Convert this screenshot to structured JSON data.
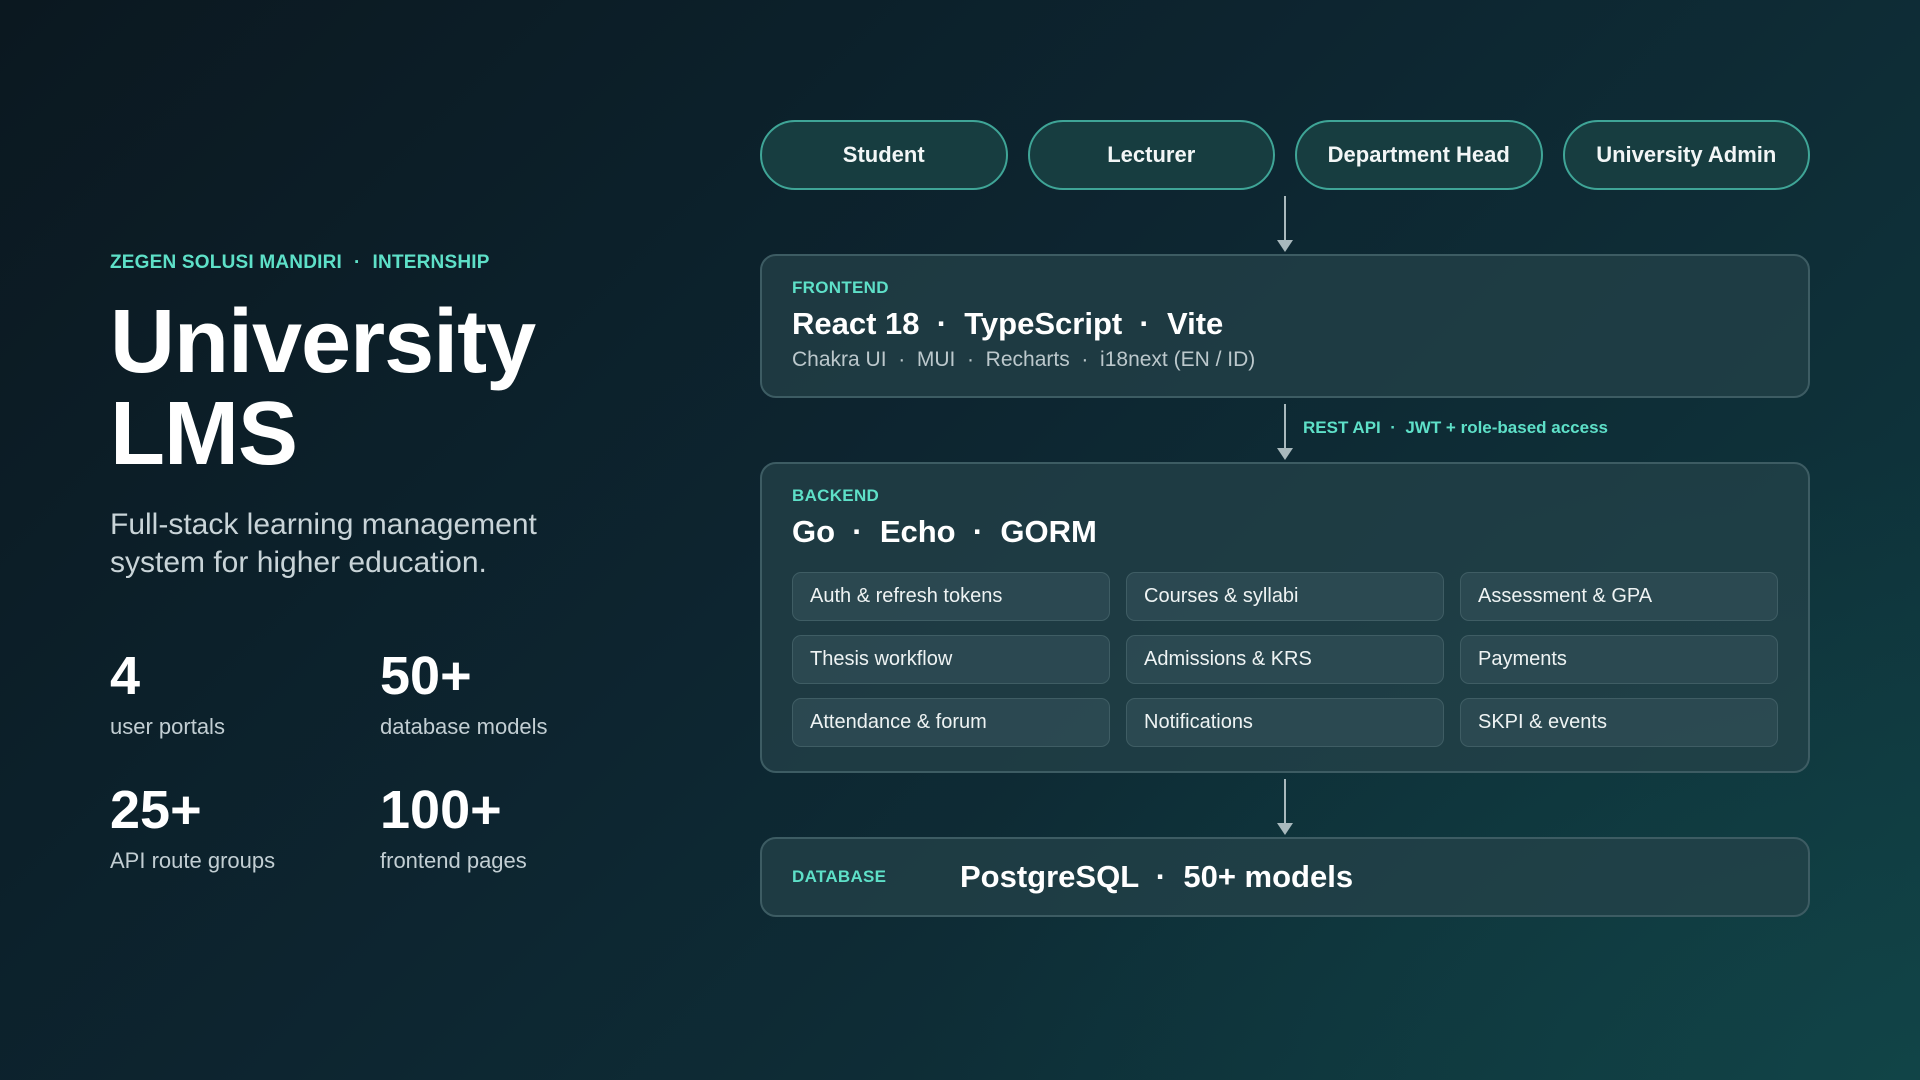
{
  "header": {
    "company": "ZEGEN SOLUSI MANDIRI",
    "separator": "·",
    "program": "INTERNSHIP"
  },
  "title": {
    "line1": "University",
    "line2": "LMS"
  },
  "subtitle": "Full-stack learning management system for higher education.",
  "stats": [
    {
      "value": "4",
      "label": "user portals"
    },
    {
      "value": "50+",
      "label": "database models"
    },
    {
      "value": "25+",
      "label": "API route groups"
    },
    {
      "value": "100+",
      "label": "frontend pages"
    }
  ],
  "roles": [
    "Student",
    "Lecturer",
    "Department Head",
    "University Admin"
  ],
  "frontend": {
    "tag": "FRONTEND",
    "main": "React 18  ·  TypeScript  ·  Vite",
    "sub": "Chakra UI  ·  MUI  ·  Recharts  ·  i18next (EN / ID)"
  },
  "connector": {
    "note": "REST API  ·  JWT + role-based access"
  },
  "backend": {
    "tag": "BACKEND",
    "main": "Go  ·  Echo  ·  GORM",
    "modules": [
      "Auth & refresh tokens",
      "Courses & syllabi",
      "Assessment & GPA",
      "Thesis workflow",
      "Admissions & KRS",
      "Payments",
      "Attendance & forum",
      "Notifications",
      "SKPI & events"
    ]
  },
  "database": {
    "tag": "DATABASE",
    "main": "PostgreSQL  ·  50+ models"
  },
  "colors": {
    "accent": "#5ee0c8",
    "role_border": "#3fa597",
    "panel_border": "#3d5c63",
    "background_start": "#0b1820",
    "background_end": "#0f3a40"
  }
}
